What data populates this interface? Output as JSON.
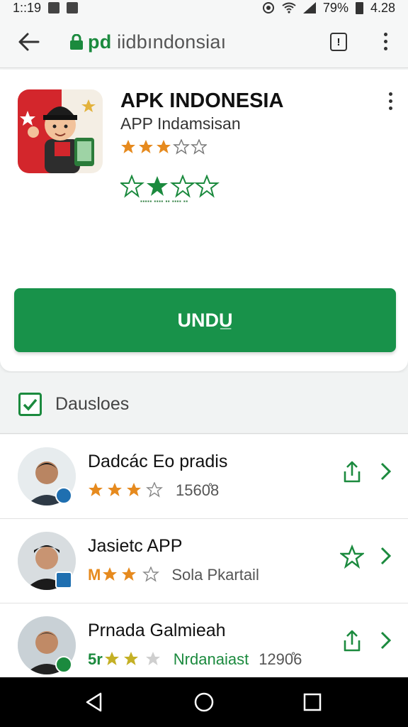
{
  "status_bar": {
    "time": "1::19",
    "battery": "79%",
    "right_time": "4.28"
  },
  "browser": {
    "url_green": "pd",
    "url_rest": " iidbındonsiaı",
    "tab_count": "!"
  },
  "app": {
    "title": "APK INDONESIA",
    "subtitle": "APP Indamsisan",
    "rating_stars": 3,
    "download_label": "UNDU̲"
  },
  "section": {
    "label": "Dauslоes"
  },
  "list": [
    {
      "title": "Dadcác Eo pradis",
      "rating_prefix": "",
      "meta": "1560̊8",
      "action": "share-icon",
      "badge_color": "#1f6fb0"
    },
    {
      "title": "Jasietc APP",
      "rating_prefix": "M",
      "meta": "Sola Pkartail",
      "action": "star-icon",
      "badge_color": "#1f6fb0"
    },
    {
      "title": "Prnada Galmieah",
      "rating_prefix": "5r",
      "meta": "Nrdanaiast",
      "meta2": "1290̊6",
      "action": "share-icon",
      "badge_color": "#1b8a3e"
    }
  ],
  "colors": {
    "accent": "#18924a",
    "star": "#e68a1e"
  }
}
